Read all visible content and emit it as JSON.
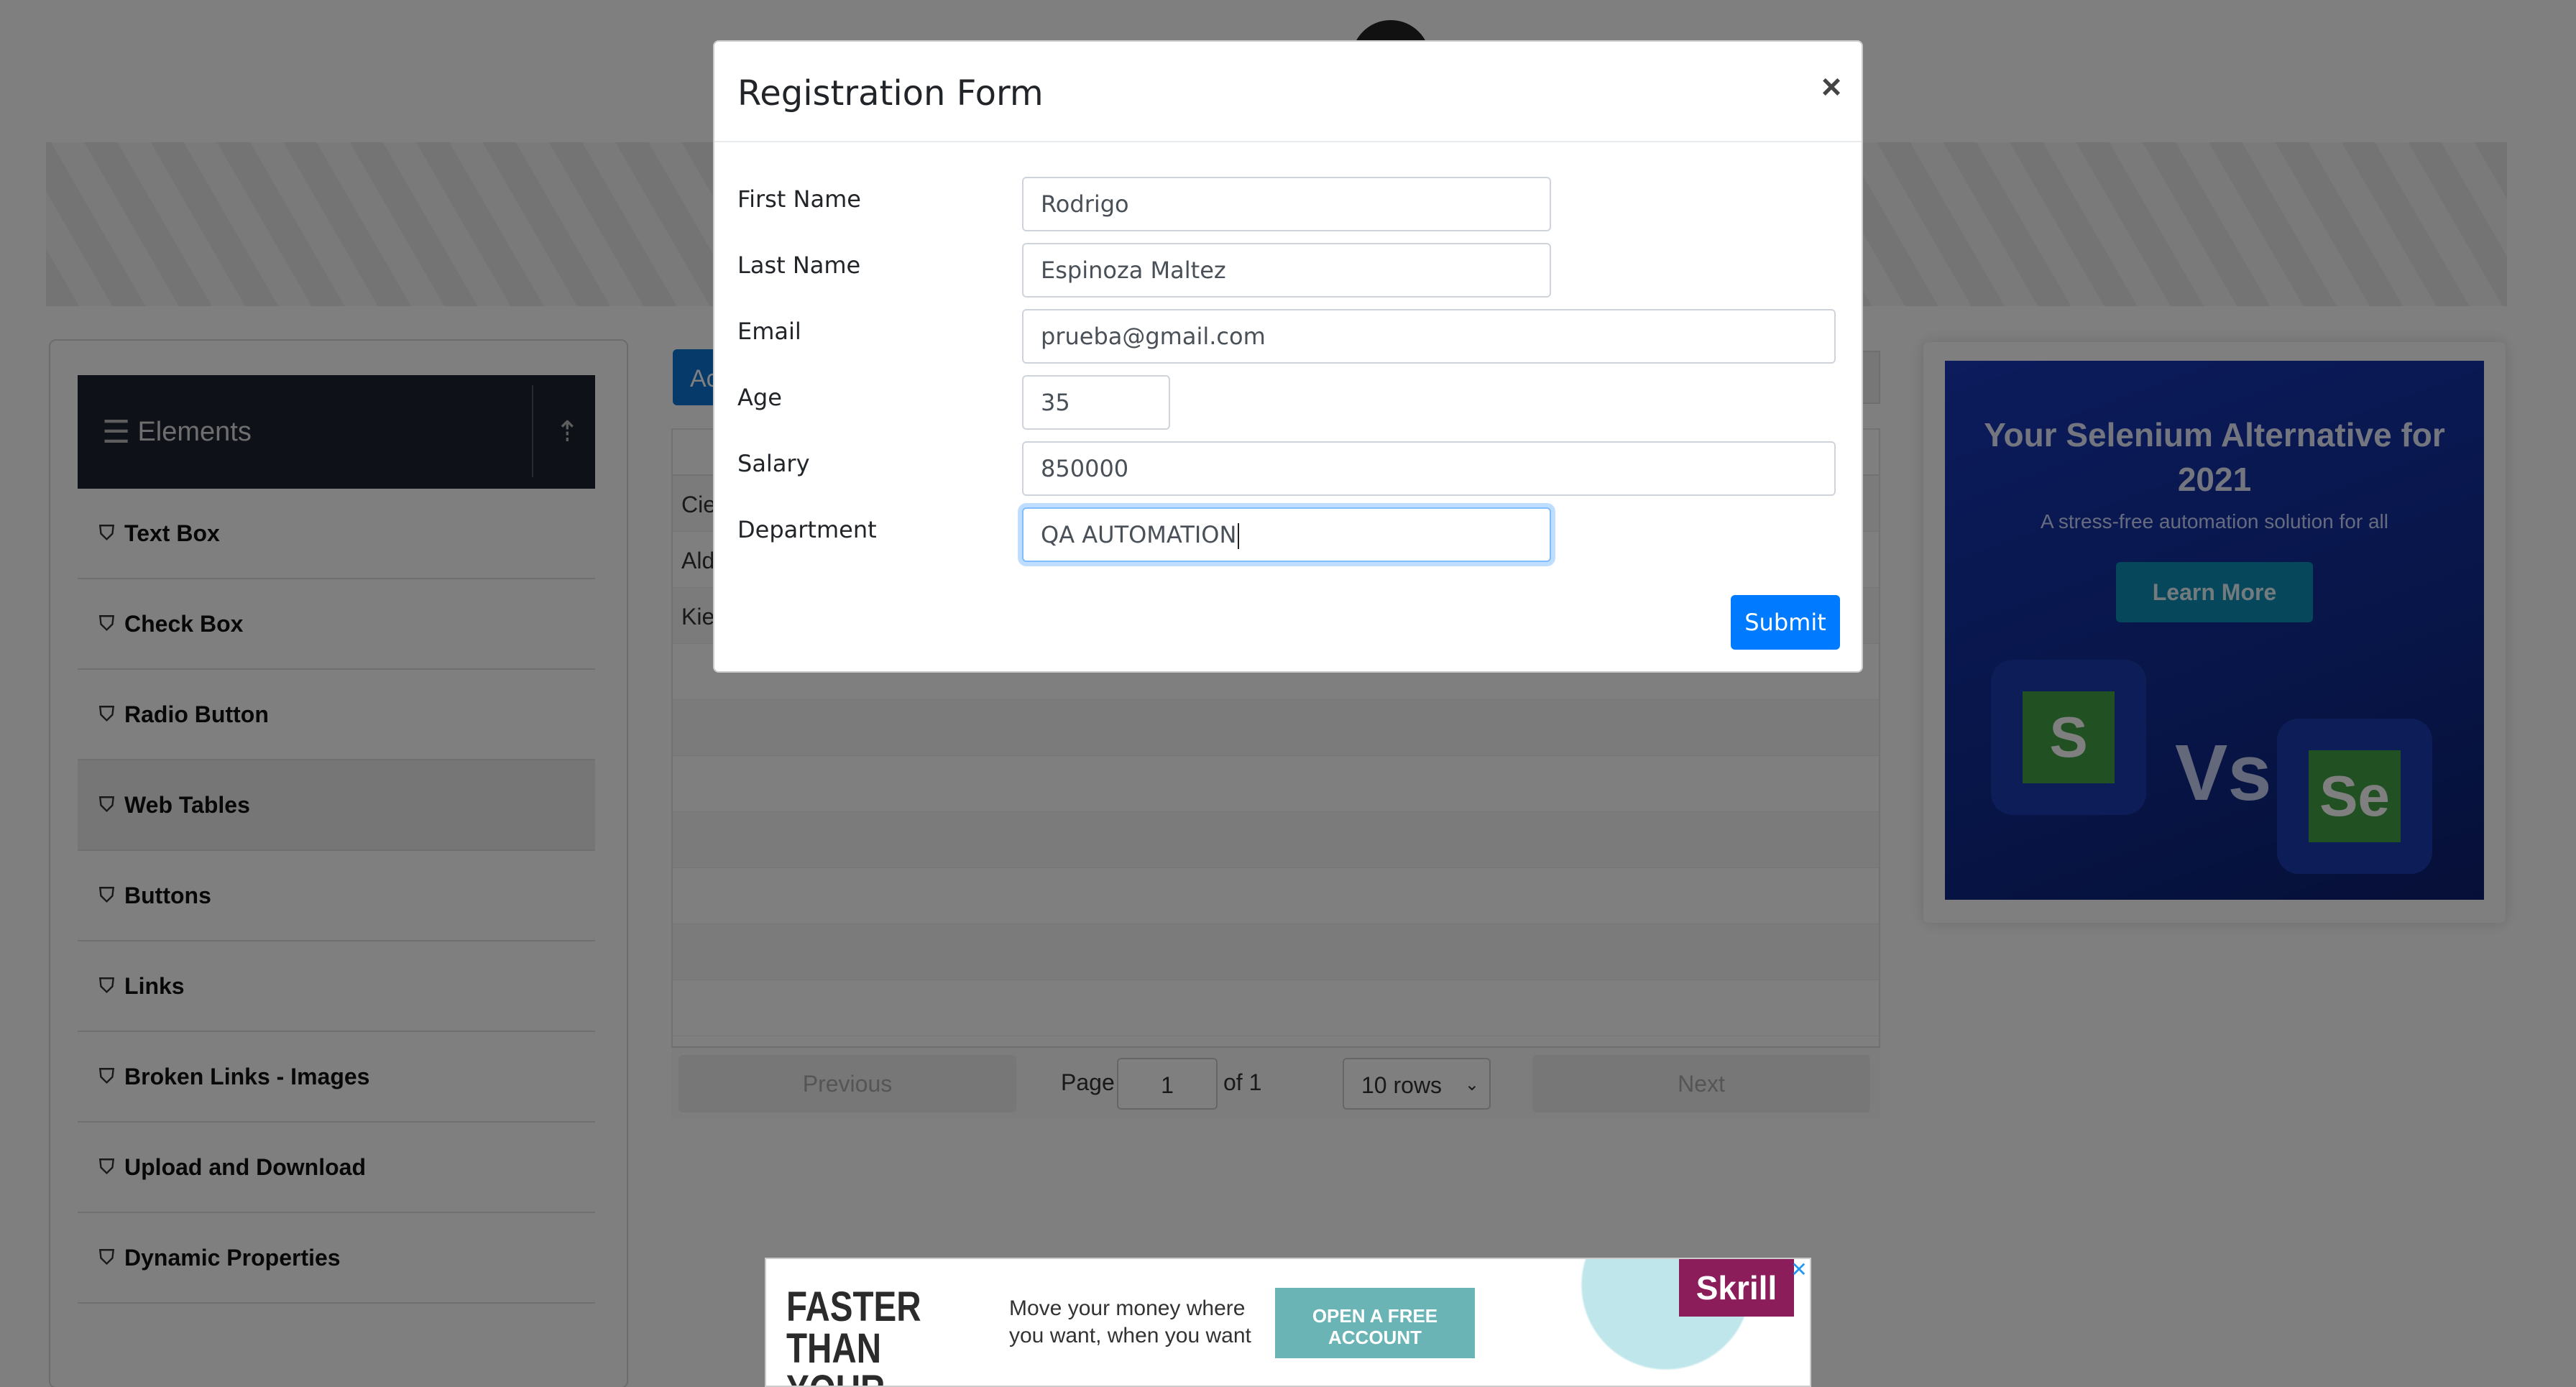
{
  "modal": {
    "title": "Registration Form",
    "close_label": "×",
    "fields": [
      {
        "label": "First Name",
        "value": "Rodrigo"
      },
      {
        "label": "Last Name",
        "value": "Espinoza Maltez"
      },
      {
        "label": "Email",
        "value": "prueba@gmail.com"
      },
      {
        "label": "Age",
        "value": "35"
      },
      {
        "label": "Salary",
        "value": "850000"
      },
      {
        "label": "Department",
        "value": "QA AUTOMATION"
      }
    ],
    "submit_label": "Submit"
  },
  "sidebar": {
    "group_title": "Elements",
    "items": [
      {
        "label": "Text Box"
      },
      {
        "label": "Check Box"
      },
      {
        "label": "Radio Button"
      },
      {
        "label": "Web Tables"
      },
      {
        "label": "Buttons"
      },
      {
        "label": "Links"
      },
      {
        "label": "Broken Links - Images"
      },
      {
        "label": "Upload and Download"
      },
      {
        "label": "Dynamic Properties"
      }
    ]
  },
  "table": {
    "add_label": "Ac",
    "rows": [
      "Cie",
      "Ald",
      "Kie"
    ],
    "pagination": {
      "previous_label": "Previous",
      "page_label": "Page",
      "page_value": "1",
      "of_label": "of 1",
      "rows_label": "10 rows",
      "next_label": "Next"
    }
  },
  "side_ad": {
    "headline": "Your Selenium Alternative for 2021",
    "subtext": "A stress-free automation solution for all",
    "cta": "Learn More",
    "vs": "Vs"
  },
  "bottom_ad": {
    "headline": "FASTER THAN YOUR BANK",
    "message": "Move your money where you want, when you want",
    "cta": "OPEN A FREE ACCOUNT",
    "brand": "Skrill",
    "close_label": "✕"
  }
}
